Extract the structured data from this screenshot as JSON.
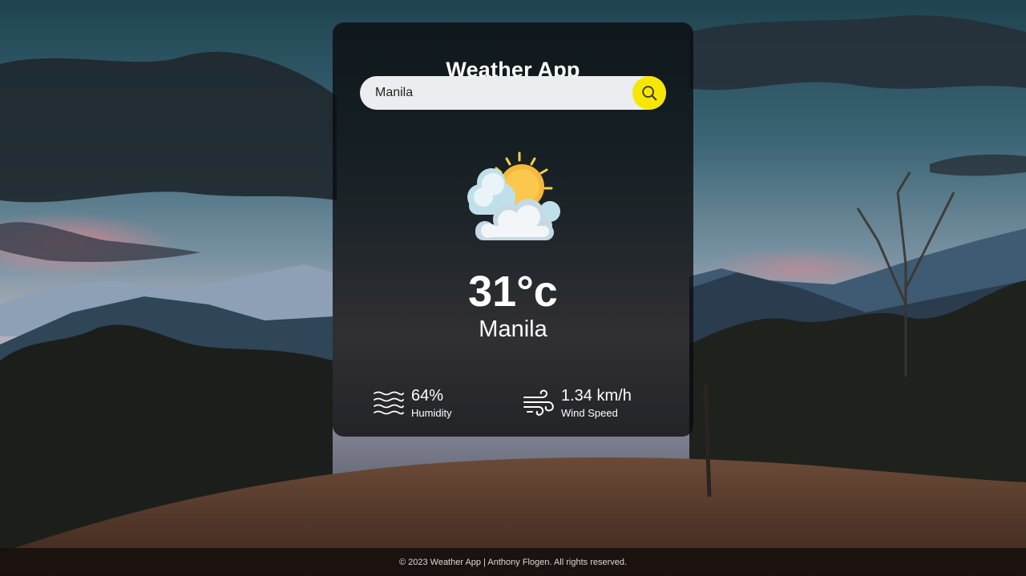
{
  "app": {
    "title": "Weather App"
  },
  "search": {
    "value": "Manila",
    "placeholder": "",
    "icon": "search-icon"
  },
  "weather": {
    "icon": "partly-cloudy-icon",
    "temperature": "31°c",
    "city": "Manila"
  },
  "details": {
    "humidity": {
      "icon": "humidity-waves-icon",
      "value": "64%",
      "label": "Humidity"
    },
    "wind": {
      "icon": "wind-icon",
      "value": "1.34 km/h",
      "label": "Wind Speed"
    }
  },
  "footer": {
    "text": "© 2023 Weather App | Anthony Flogen. All rights reserved."
  },
  "colors": {
    "search_button": "#f7e600",
    "card_background": "#0a0a0c",
    "search_background": "#ebedf0"
  }
}
